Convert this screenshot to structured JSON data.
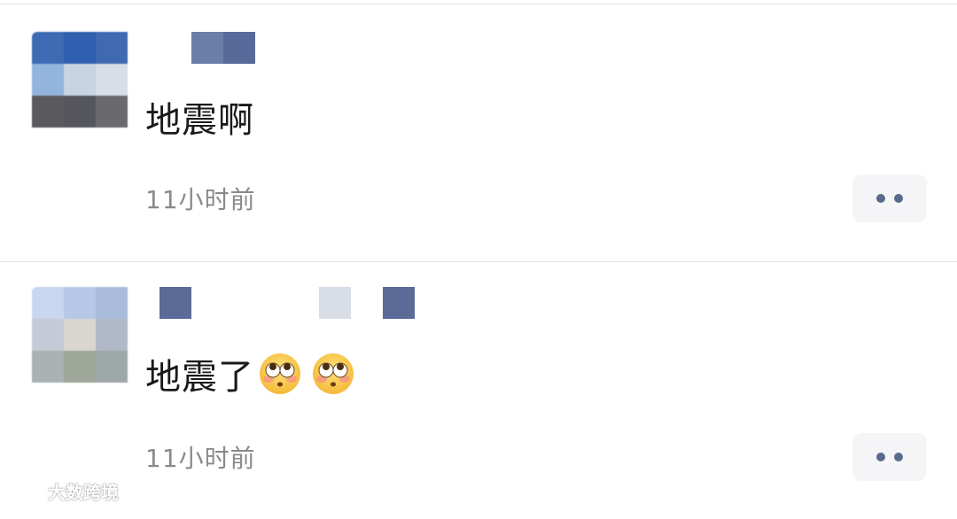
{
  "comments": [
    {
      "text": "地震啊",
      "time": "11小时前",
      "avatar_colors": [
        "#3d6bb4",
        "#2f5fae",
        "#3f69b1",
        "#93b4dc",
        "#c8d4e2",
        "#d8dde6",
        "#5a5a5e",
        "#55565c",
        "#6a6a6e"
      ],
      "name_colors": [
        "#6a7ea8",
        "#586a9a"
      ]
    },
    {
      "text": "地震了",
      "emoji_count": 2,
      "time": "11小时前",
      "avatar_colors": [
        "#c9d6ef",
        "#b7c8e6",
        "#a9bcdc",
        "#c5cad6",
        "#d9d6cf",
        "#b1b8c8",
        "#aab2b3",
        "#9ea79a",
        "#9ea7a8"
      ],
      "name_colors": [
        "#5b6a96",
        "#d8dde6",
        "#5b6a96"
      ]
    }
  ],
  "more_icon": "more-dots-icon",
  "emoji_icon": "flushed-face-emoji",
  "watermark": {
    "text": "大数跨境"
  },
  "colors": {
    "text": "#1a1a1a",
    "timestamp": "#8a8a8a",
    "dot": "#5a6a8c"
  }
}
